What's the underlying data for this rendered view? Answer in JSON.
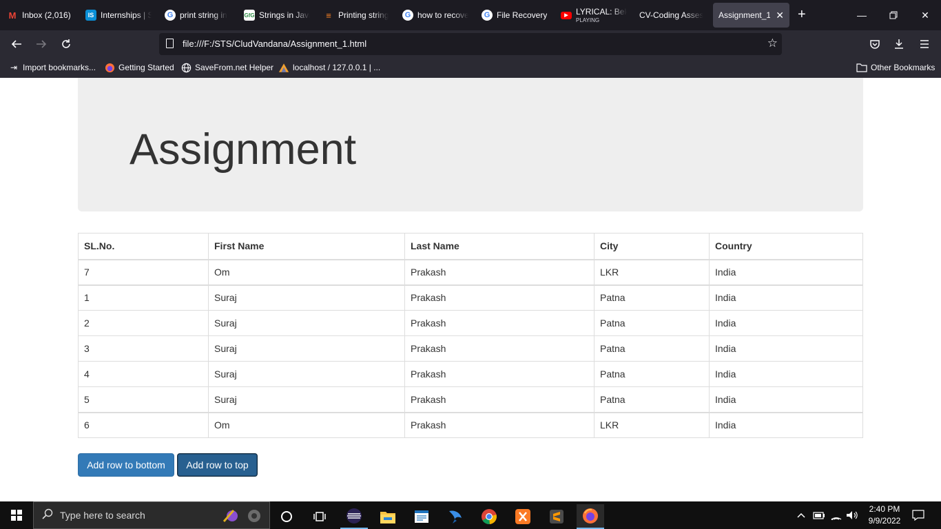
{
  "browser": {
    "tabs": [
      {
        "title": "Inbox (2,016)",
        "icon": "gmail-icon",
        "color": "#ea4335"
      },
      {
        "title": "Internships | S",
        "icon": "internshala-icon",
        "color": "#0a8fd6"
      },
      {
        "title": "print string in",
        "icon": "google-icon",
        "color": "#4285f4"
      },
      {
        "title": "Strings in Java",
        "icon": "geeks-icon",
        "color": "#2f8d46"
      },
      {
        "title": "Printing string",
        "icon": "stackoverflow-icon",
        "color": "#f48024"
      },
      {
        "title": "how to recove",
        "icon": "google-icon",
        "color": "#4285f4"
      },
      {
        "title": "File Recovery",
        "icon": "google-icon",
        "color": "#4285f4"
      },
      {
        "title": "LYRICAL: Bekh",
        "subtitle": "PLAYING",
        "icon": "youtube-icon",
        "color": "#ff0000"
      },
      {
        "title": "CV-Coding Asses",
        "icon": "blank-icon",
        "color": "#1c1b22"
      },
      {
        "title": "Assignment_1",
        "icon": "none",
        "active": true
      }
    ],
    "url": "file:///F:/STS/CludVandana/Assignment_1.html",
    "bookmarks": [
      {
        "label": "Import bookmarks...",
        "icon": "import-icon"
      },
      {
        "label": "Getting Started",
        "icon": "firefox-icon"
      },
      {
        "label": "SaveFrom.net Helper",
        "icon": "globe-icon"
      },
      {
        "label": "localhost / 127.0.0.1 | ...",
        "icon": "phpmyadmin-icon"
      }
    ],
    "other_bookmarks": "Other Bookmarks"
  },
  "page": {
    "heading": "Assignment",
    "table": {
      "headers": [
        "SL.No.",
        "First Name",
        "Last Name",
        "City",
        "Country"
      ],
      "rows": [
        [
          "7",
          "Om",
          "Prakash",
          "LKR",
          "India"
        ],
        [
          "1",
          "Suraj",
          "Prakash",
          "Patna",
          "India"
        ],
        [
          "2",
          "Suraj",
          "Prakash",
          "Patna",
          "India"
        ],
        [
          "3",
          "Suraj",
          "Prakash",
          "Patna",
          "India"
        ],
        [
          "4",
          "Suraj",
          "Prakash",
          "Patna",
          "India"
        ],
        [
          "5",
          "Suraj",
          "Prakash",
          "Patna",
          "India"
        ],
        [
          "6",
          "Om",
          "Prakash",
          "LKR",
          "India"
        ]
      ]
    },
    "buttons": {
      "add_bottom": "Add row to bottom",
      "add_top": "Add row to top"
    }
  },
  "taskbar": {
    "search_placeholder": "Type here to search",
    "time": "2:40 PM",
    "date": "9/9/2022",
    "apps": [
      "cortana-icon",
      "task-view-icon",
      "eclipse-icon",
      "file-explorer-icon",
      "notepad-icon",
      "fish-icon",
      "chrome-icon",
      "xampp-icon",
      "sublime-icon",
      "firefox-icon"
    ]
  },
  "colors": {
    "browser_dark": "#1c1b22",
    "toolbar": "#2b2a33",
    "jumbotron": "#eeeeee",
    "primary_button": "#337ab7"
  }
}
